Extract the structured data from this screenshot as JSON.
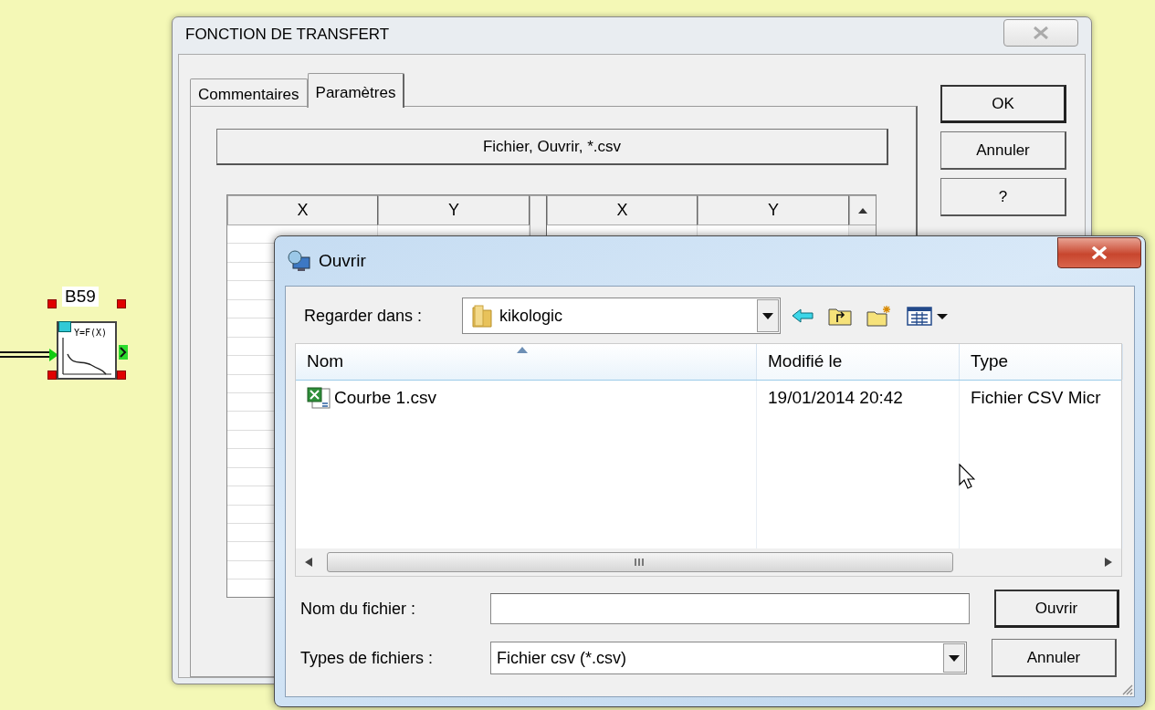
{
  "canvas": {
    "block": {
      "label": "B59",
      "formula": "Y=F(X)",
      "selected": true
    }
  },
  "transfer_dialog": {
    "title": "FONCTION DE TRANSFERT",
    "tabs": [
      {
        "label": "Commentaires",
        "selected": false
      },
      {
        "label": "Paramètres",
        "selected": true
      }
    ],
    "file_button": "Fichier, Ouvrir, *.csv",
    "table": {
      "columns": [
        "X",
        "Y",
        "X",
        "Y"
      ]
    },
    "buttons": [
      {
        "kind": "ok",
        "label": "OK"
      },
      {
        "kind": "cancel",
        "label": "Annuler"
      },
      {
        "kind": "help",
        "label": "?"
      }
    ]
  },
  "open_dialog": {
    "title": "Ouvrir",
    "look_in": {
      "label": "Regarder dans :",
      "value": "kikologic"
    },
    "columns": [
      {
        "label": "Nom",
        "sorted": true
      },
      {
        "label": "Modifié le",
        "sorted": false
      },
      {
        "label": "Type",
        "sorted": false
      }
    ],
    "files": [
      {
        "name": "Courbe 1.csv",
        "modified": "19/01/2014 20:42",
        "type": "Fichier CSV Micr"
      }
    ],
    "file_name": {
      "label": "Nom du fichier :"
    },
    "file_type": {
      "label": "Types de fichiers :",
      "value": "Fichier csv (*.csv)"
    },
    "buttons": [
      {
        "kind": "open",
        "label": "Ouvrir"
      },
      {
        "kind": "cancel",
        "label": "Annuler"
      }
    ]
  }
}
